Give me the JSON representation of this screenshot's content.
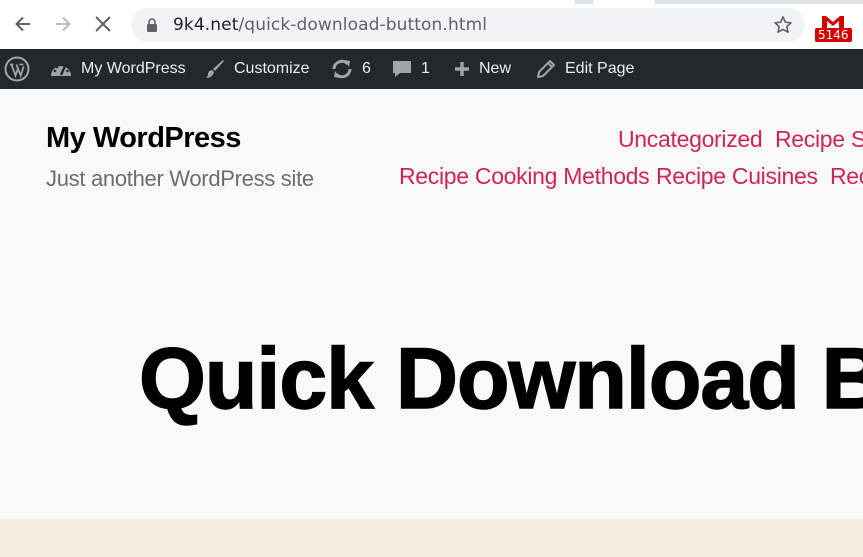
{
  "browser": {
    "url_host": "9k4.net",
    "url_path": "/quick-download-button.html",
    "extension_badge": "5146",
    "icons": [
      "back-arrow-icon",
      "forward-arrow-icon",
      "stop-loading-icon",
      "lock-icon",
      "bookmark-star-icon",
      "gmail-extension-icon"
    ]
  },
  "adminbar": {
    "site_name": "My WordPress",
    "customize": "Customize",
    "updates_count": "6",
    "comments_count": "1",
    "new_label": "New",
    "edit_page": "Edit Page"
  },
  "site": {
    "title": "My WordPress",
    "description": "Just another WordPress site"
  },
  "menu": {
    "items": [
      "Uncategorized",
      "Recipe Se",
      "Recipe Cooking Methods",
      "Recipe Cuisines",
      "Rec"
    ]
  },
  "page": {
    "title": "Quick Download B"
  },
  "colors": {
    "adminbar_bg": "#23282d",
    "accent": "#cd2653",
    "page_bg": "#f9f9f9",
    "band_bg": "#f5efe0"
  }
}
